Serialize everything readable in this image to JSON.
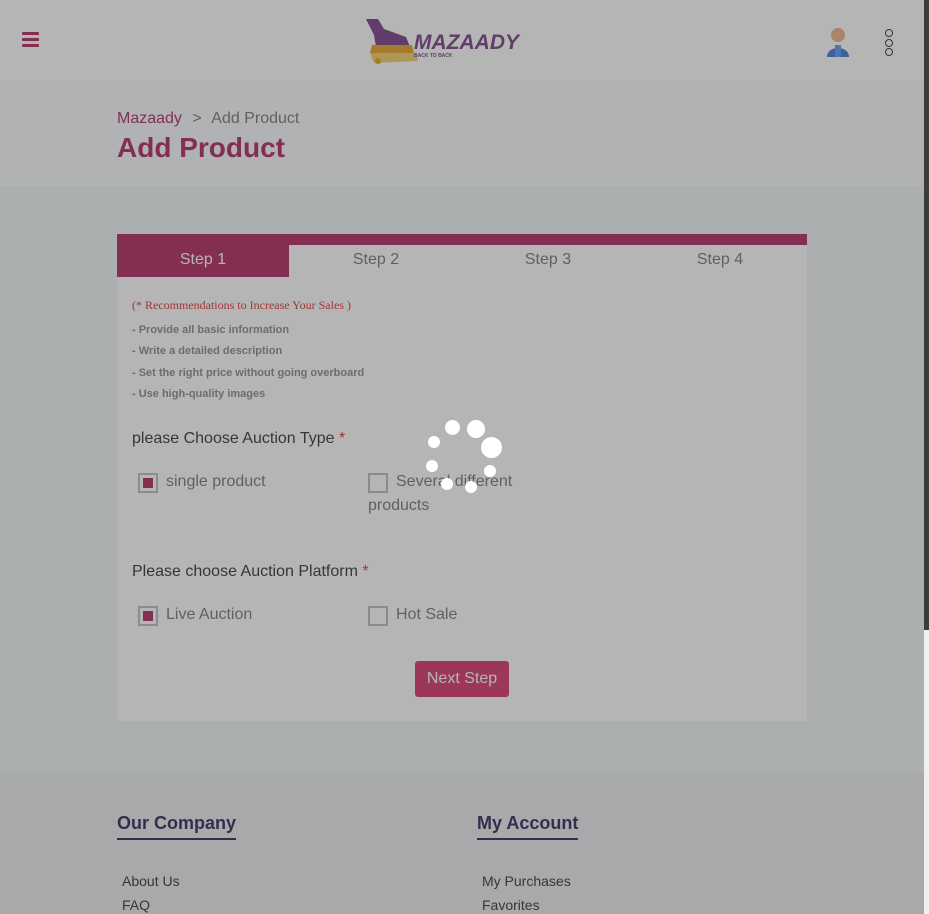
{
  "header": {
    "logo": {
      "brand": "MAZAADY",
      "tagline": "BACK TO BACK"
    }
  },
  "breadcrumb": {
    "home": "Mazaady",
    "separator": ">",
    "current": "Add Product"
  },
  "page_title": "Add Product",
  "steps": [
    {
      "label": "Step 1",
      "active": true
    },
    {
      "label": "Step 2",
      "active": false
    },
    {
      "label": "Step 3",
      "active": false
    },
    {
      "label": "Step 4",
      "active": false
    }
  ],
  "recommendations": {
    "title": "(* Recommendations to Increase Your Sales )",
    "items": [
      "- Provide all basic information",
      "- Write a detailed description",
      "- Set the right price without going overboard",
      "- Use high-quality images"
    ]
  },
  "auction_type": {
    "question": "please Choose Auction Type",
    "required_mark": "*",
    "options": [
      {
        "label": "single product",
        "checked": true
      },
      {
        "label": "Several different products",
        "checked": false
      }
    ]
  },
  "auction_platform": {
    "question": "Please choose Auction Platform",
    "required_mark": "*",
    "options": [
      {
        "label": "Live Auction",
        "checked": true
      },
      {
        "label": "Hot Sale",
        "checked": false
      }
    ]
  },
  "next_button": "Next Step",
  "footer": {
    "our_company": {
      "heading": "Our Company",
      "links": [
        "About Us",
        "FAQ"
      ]
    },
    "my_account": {
      "heading": "My Account",
      "links": [
        "My Purchases",
        "Favorites"
      ]
    }
  },
  "colors": {
    "brand": "#b0265f",
    "brand_button": "#d8336e",
    "required": "#e0312f",
    "footer_heading": "#33245a"
  },
  "icons": [
    "hamburger-menu-icon",
    "user-avatar-icon",
    "more-vertical-icon",
    "loading-spinner-icon"
  ]
}
